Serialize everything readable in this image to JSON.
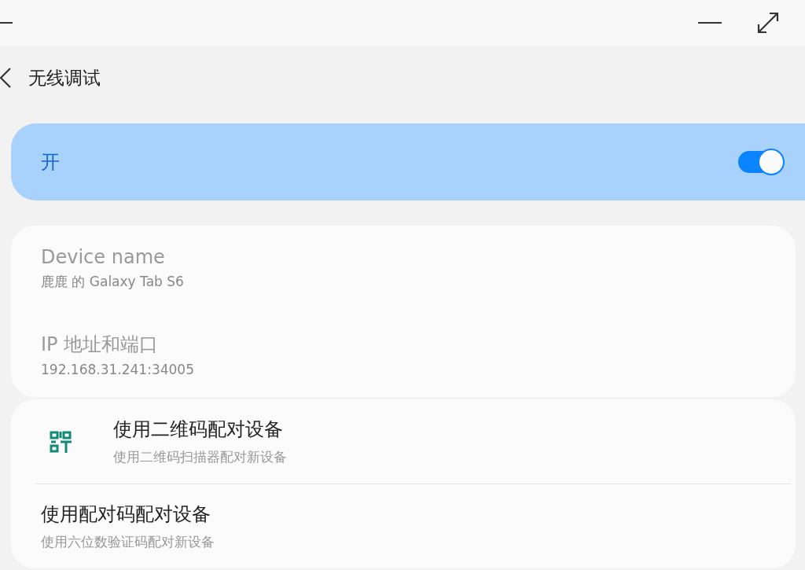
{
  "header": {
    "title": "无线调试"
  },
  "master_switch": {
    "label": "开",
    "on": true
  },
  "info": [
    {
      "title": "Device name",
      "value": "鹿鹿 的 Galaxy Tab S6"
    },
    {
      "title": "IP 地址和端口",
      "value": "192.168.31.241:34005"
    }
  ],
  "pairing": [
    {
      "kind": "qr",
      "title": "使用二维码配对设备",
      "subtitle": "使用二维码扫描器配对新设备"
    },
    {
      "kind": "plain",
      "title": "使用配对码配对设备",
      "subtitle": "使用六位数验证码配对新设备"
    }
  ]
}
